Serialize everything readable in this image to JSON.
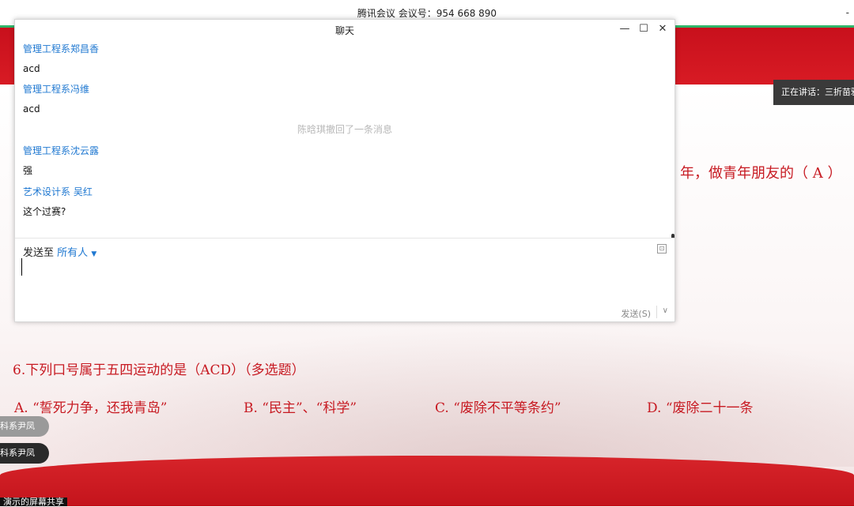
{
  "meeting": {
    "title": "腾讯会议 会议号：954 668 890",
    "top_right": "-"
  },
  "speaking": "正在讲话：三折苗雅",
  "chat": {
    "title": "聊天",
    "controls": {
      "minimize": "—",
      "maximize": "☐",
      "close": "✕"
    },
    "messages": [
      {
        "sender": "管理工程系郑昌香",
        "text": "acd"
      },
      {
        "sender": "管理工程系冯维",
        "text": "acd"
      },
      {
        "system": "陈晗琪撤回了一条消息"
      },
      {
        "sender": "管理工程系沈云露",
        "text": "强"
      },
      {
        "sender": "艺术设计系 吴红",
        "text": "这个过赛?"
      }
    ],
    "send_to_label": "发送至",
    "send_to_target": "所有人",
    "caret": "▼",
    "expand_icon": "⊡",
    "send_button": "发送(S)",
    "send_arrow": "∨",
    "input_value": ""
  },
  "slide": {
    "q5_tail": "年，做青年朋友的（ A ）",
    "q6": "6.下列口号属于五四运动的是（ACD）（多选题）",
    "options": {
      "a": "A. “誓死力争，还我青岛”",
      "b": "B. “民主”、“科学”",
      "c": "C. “废除不平等条约”",
      "d": "D. “废除二十一条"
    }
  },
  "participants": {
    "pill1": "科系尹凤",
    "pill2": "科系尹凤",
    "bottom_label": "演示的屏幕共享"
  },
  "colors": {
    "accent_red": "#c71a22",
    "link_blue": "#1f78d1",
    "meeting_green": "#2fb56a"
  }
}
